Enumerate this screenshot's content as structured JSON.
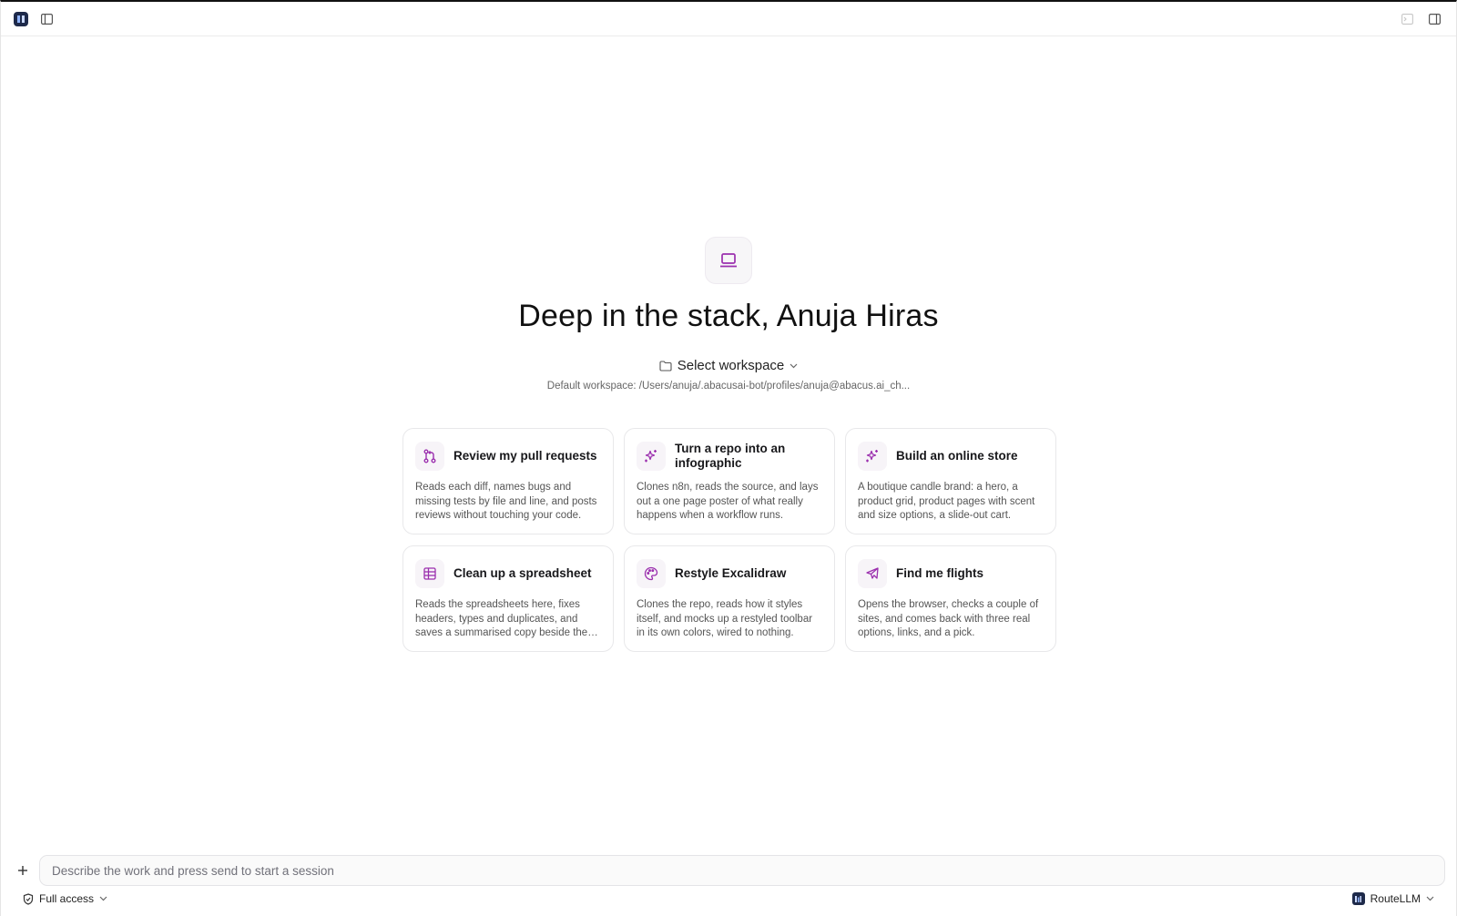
{
  "hero": {
    "title": "Deep in the stack, Anuja Hiras",
    "workspace_label": "Select workspace",
    "default_workspace": "Default workspace: /Users/anuja/.abacusai-bot/profiles/anuja@abacus.ai_ch..."
  },
  "cards": [
    {
      "icon": "git-pull-request-icon",
      "title": "Review my pull requests",
      "desc": "Reads each diff, names bugs and missing tests by file and line, and posts reviews without touching your code."
    },
    {
      "icon": "sparkles-icon",
      "title": "Turn a repo into an infographic",
      "desc": "Clones n8n, reads the source, and lays out a one page poster of what really happens when a workflow runs."
    },
    {
      "icon": "sparkles-icon",
      "title": "Build an online store",
      "desc": "A boutique candle brand: a hero, a product grid, product pages with scent and size options, a slide-out cart."
    },
    {
      "icon": "table-icon",
      "title": "Clean up a spreadsheet",
      "desc": "Reads the spreadsheets here, fixes headers, types and duplicates, and saves a summarised copy beside the original."
    },
    {
      "icon": "palette-icon",
      "title": "Restyle Excalidraw",
      "desc": "Clones the repo, reads how it styles itself, and mocks up a restyled toolbar in its own colors, wired to nothing."
    },
    {
      "icon": "plane-icon",
      "title": "Find me flights",
      "desc": "Opens the browser, checks a couple of sites, and comes back with three real options, links, and a pick."
    }
  ],
  "composer": {
    "placeholder": "Describe the work and press send to start a session"
  },
  "footer": {
    "access_label": "Full access",
    "model_label": "RouteLLM"
  },
  "colors": {
    "accent": "#9b2fae",
    "logo_bg": "#1e2a4a"
  }
}
